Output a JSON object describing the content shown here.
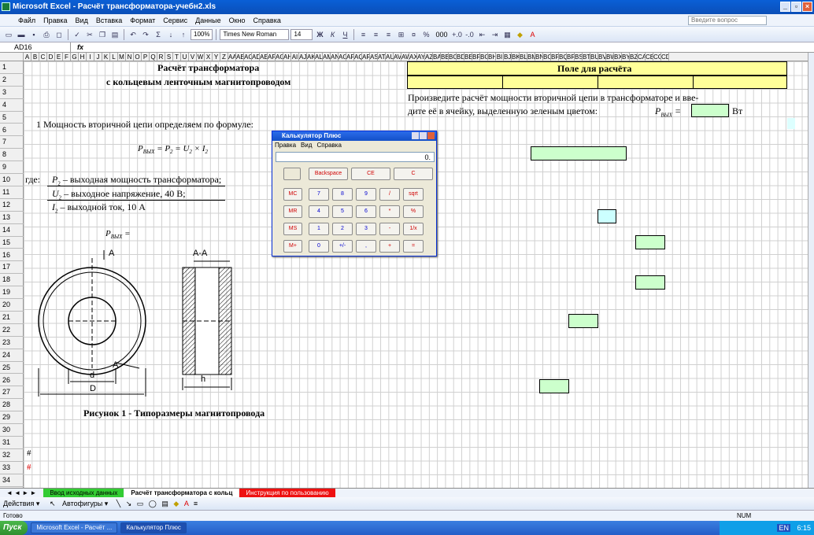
{
  "window": {
    "title": "Microsoft Excel - Расчёт трансформатора-учебн2.xls"
  },
  "menu": [
    "Файл",
    "Правка",
    "Вид",
    "Вставка",
    "Формат",
    "Сервис",
    "Данные",
    "Окно",
    "Справка"
  ],
  "ask_placeholder": "Введите вопрос",
  "toolbar": {
    "zoom": "100%",
    "font": "Times New Roman",
    "size": "14",
    "bold": "Ж",
    "italic": "К",
    "underline": "Ч",
    "percent": "%",
    "thousands": "000"
  },
  "formula": {
    "cell": "AD16",
    "fx": "fx",
    "value": ""
  },
  "columns": [
    "A",
    "B",
    "C",
    "D",
    "E",
    "F",
    "G",
    "H",
    "I",
    "J",
    "K",
    "L",
    "M",
    "N",
    "O",
    "P",
    "Q",
    "R",
    "S",
    "T",
    "U",
    "V",
    "W",
    "X",
    "Y",
    "Z",
    "AA",
    "AB",
    "AC",
    "AD",
    "AE",
    "AF",
    "AG",
    "AH",
    "AI",
    "AJ",
    "AK",
    "AL",
    "AM",
    "AN",
    "AO",
    "AP",
    "AQ",
    "AR",
    "AS",
    "AT",
    "AU",
    "AV",
    "AW",
    "AX",
    "AY",
    "AZ",
    "BA",
    "BB",
    "BC",
    "BD",
    "BE",
    "BF",
    "BG",
    "BH",
    "BI",
    "BJ",
    "BK",
    "BL",
    "BM",
    "BN",
    "BO",
    "BP",
    "BQ",
    "BR",
    "BS",
    "BT",
    "BU",
    "BV",
    "BW",
    "BX",
    "BY",
    "BZ",
    "CA",
    "CB",
    "CC",
    "CD"
  ],
  "rows": [
    "1",
    "2",
    "3",
    "4",
    "5",
    "6",
    "7",
    "8",
    "9",
    "10",
    "11",
    "12",
    "13",
    "14",
    "15",
    "16",
    "17",
    "18",
    "19",
    "20",
    "21",
    "22",
    "23",
    "24",
    "25",
    "26",
    "27",
    "28",
    "29",
    "30",
    "31",
    "32",
    "33",
    "34"
  ],
  "sheet": {
    "title1": "Расчёт трансформатора",
    "title2": "с кольцевым ленточным магнитопроводом",
    "calc_field": "Поле для расчёта",
    "instruction1": "Произведите расчёт мощности вторичной цепи в трансформаторе и вве-",
    "instruction2": "дите её в ячейку, выделенную зеленым цветом:",
    "p_label": "P",
    "p_sub": "ВЫХ",
    "eq": " =",
    "unit": "Вт",
    "step1": "1 Мощность вторичной цепи определяем по формуле:",
    "formula_main_a": "P",
    "formula_main_b": " = P",
    "formula_main_c": " = U",
    "formula_main_d": " × I",
    "sub_out": "ВЫХ",
    "sub_2": "2",
    "where": "где:",
    "def1_sym": "P",
    "def1": " – выходная мощность трансформатора;",
    "def2_sym": "U",
    "def2": " – выходное напряжение, 40 В;",
    "def3_sym": "I",
    "def3": " – выходной ток, 10 А",
    "pvyx": "P",
    "pvyx_eq": " =",
    "figure_caption": "Рисунок 1 - Типоразмеры магнитопровода",
    "hash1": "#",
    "hash2": "#",
    "dim_a": "A",
    "dim_aa": "A-A",
    "dim_a2": "A",
    "dim_d": "d",
    "dim_D": "D",
    "dim_h": "h"
  },
  "calculator": {
    "title": "Калькулятор Плюс",
    "menu": [
      "Правка",
      "Вид",
      "Справка"
    ],
    "display": "0.",
    "row0": [
      "Backspace",
      "CE",
      "C"
    ],
    "keys": [
      [
        "MC",
        "7",
        "8",
        "9",
        "/",
        "sqrt"
      ],
      [
        "MR",
        "4",
        "5",
        "6",
        "*",
        "%"
      ],
      [
        "MS",
        "1",
        "2",
        "3",
        "-",
        "1/x"
      ],
      [
        "M+",
        "0",
        "+/-",
        ",",
        "+",
        "="
      ]
    ]
  },
  "tabs": {
    "nav": "◄ ◄ ► ►",
    "t1": "Ввод исходных данных",
    "t2": "Расчёт трансформатора с кольц",
    "t3": "Инструкция по пользованию"
  },
  "drawbar": {
    "actions": "Действия ▾",
    "autoshapes": "Автофигуры ▾"
  },
  "status": {
    "ready": "Готово",
    "num": "NUM"
  },
  "taskbar": {
    "start": "Пуск",
    "task1": "Microsoft Excel - Расчёт ...",
    "task2": "Калькулятор Плюс",
    "lang": "EN",
    "time": "6:15"
  }
}
